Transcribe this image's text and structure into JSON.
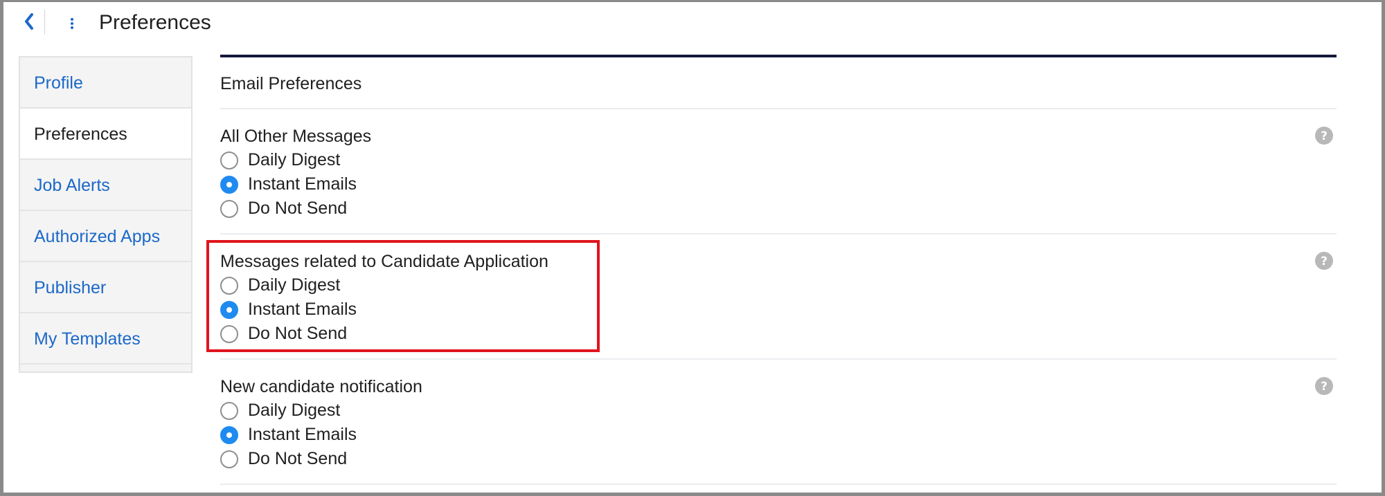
{
  "header": {
    "title": "Preferences",
    "back_icon": "chevron-left-icon",
    "menu_icon": "kebab-menu-icon",
    "accent_color": "#1c68c9"
  },
  "sidebar": {
    "items": [
      {
        "label": "Profile",
        "active": false
      },
      {
        "label": "Preferences",
        "active": true
      },
      {
        "label": "Job Alerts",
        "active": false
      },
      {
        "label": "Authorized Apps",
        "active": false
      },
      {
        "label": "Publisher",
        "active": false
      },
      {
        "label": "My Templates",
        "active": false
      }
    ]
  },
  "main": {
    "section_title": "Email Preferences",
    "groups": [
      {
        "title": "All Other Messages",
        "help_icon": "question-circle-icon",
        "options": [
          {
            "label": "Daily Digest",
            "checked": false
          },
          {
            "label": "Instant Emails",
            "checked": true
          },
          {
            "label": "Do Not Send",
            "checked": false
          }
        ]
      },
      {
        "title": "Messages related to Candidate Application",
        "help_icon": "question-circle-icon",
        "highlighted": true,
        "options": [
          {
            "label": "Daily Digest",
            "checked": false
          },
          {
            "label": "Instant Emails",
            "checked": true
          },
          {
            "label": "Do Not Send",
            "checked": false
          }
        ]
      },
      {
        "title": "New candidate notification",
        "help_icon": "question-circle-icon",
        "options": [
          {
            "label": "Daily Digest",
            "checked": false
          },
          {
            "label": "Instant Emails",
            "checked": true
          },
          {
            "label": "Do Not Send",
            "checked": false
          }
        ]
      }
    ]
  },
  "colors": {
    "radio_checked": "#1f8bf0",
    "highlight_border": "#e0141d",
    "top_rule": "#15193a"
  }
}
